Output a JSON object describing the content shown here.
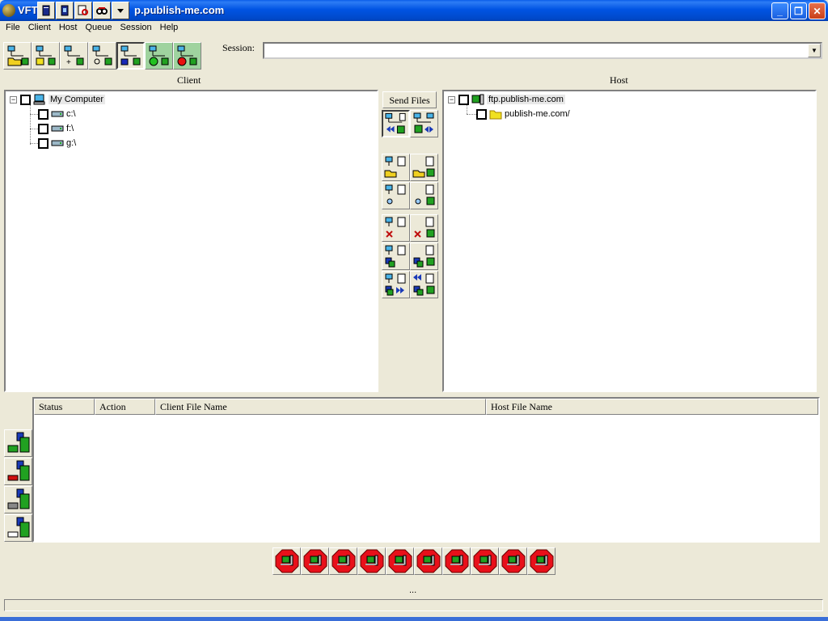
{
  "window": {
    "title_prefix": "VFT",
    "title_suffix": "p.publish-me.com"
  },
  "menu": [
    "File",
    "Client",
    "Host",
    "Queue",
    "Session",
    "Help"
  ],
  "session": {
    "label": "Session:",
    "value": ""
  },
  "panels": {
    "client_title": "Client",
    "host_title": "Host"
  },
  "client_tree": {
    "root": "My Computer",
    "drives": [
      "c:\\",
      "f:\\",
      "g:\\"
    ]
  },
  "host_tree": {
    "root": "ftp.publish-me.com",
    "folders": [
      "publish-me.com/"
    ]
  },
  "middle": {
    "send_files": "Send Files"
  },
  "queue": {
    "columns": [
      "Status",
      "Action",
      "Client File Name",
      "Host File Name"
    ]
  },
  "status": {
    "ellipsis": "..."
  },
  "colors": {
    "title_blue": "#0054e3",
    "stop_red": "#e8101a",
    "green": "#21a121"
  }
}
